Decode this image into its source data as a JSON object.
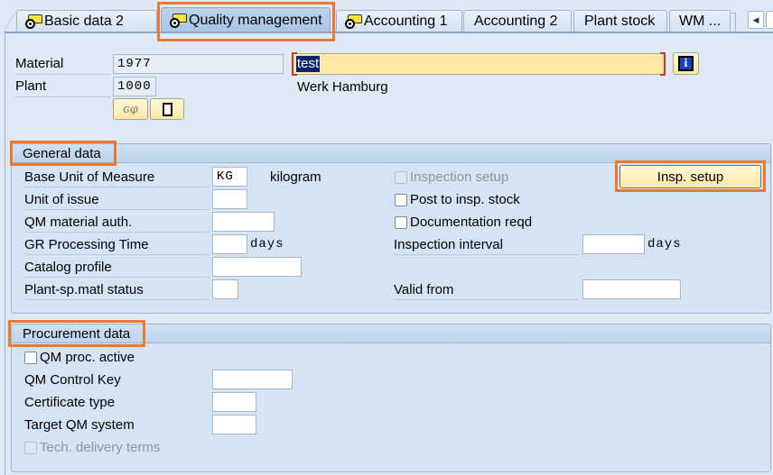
{
  "tabs": [
    {
      "label": "Basic data 2",
      "icon": "camera-lens-icon",
      "active": false
    },
    {
      "label": "Quality management",
      "icon": "camera-lens-icon",
      "active": true
    },
    {
      "label": "Accounting 1",
      "icon": "camera-lens-icon",
      "active": false
    },
    {
      "label": "Accounting 2",
      "active": false
    },
    {
      "label": "Plant stock",
      "active": false
    },
    {
      "label": "WM ...",
      "active": false
    }
  ],
  "tab_scroll": {
    "left_icon": "◀"
  },
  "header": {
    "material_label": "Material",
    "material_value": "1977",
    "material_desc": "test",
    "plant_label": "Plant",
    "plant_value": "1000",
    "plant_desc": "Werk Hamburg",
    "info_icon": "i"
  },
  "general_data": {
    "title": "General data",
    "base_uom_label": "Base Unit of Measure",
    "base_uom_value": "KG",
    "base_uom_text": "kilogram",
    "unit_of_issue_label": "Unit of issue",
    "unit_of_issue_value": "",
    "qm_material_auth_label": "QM material auth.",
    "qm_material_auth_value": "",
    "gr_processing_time_label": "GR Processing Time",
    "gr_processing_time_value": "",
    "gr_processing_time_unit": "days",
    "catalog_profile_label": "Catalog profile",
    "catalog_profile_value": "",
    "plant_matl_status_label": "Plant-sp.matl status",
    "plant_matl_status_value": "",
    "inspection_setup_label": "Inspection setup",
    "inspection_setup_checked": false,
    "insp_setup_button": "Insp. setup",
    "post_to_insp_stock_label": "Post to insp. stock",
    "post_to_insp_stock_checked": false,
    "documentation_reqd_label": "Documentation reqd",
    "documentation_reqd_checked": false,
    "inspection_interval_label": "Inspection interval",
    "inspection_interval_value": "",
    "inspection_interval_unit": "days",
    "valid_from_label": "Valid from",
    "valid_from_value": ""
  },
  "procurement_data": {
    "title": "Procurement data",
    "qm_proc_active_label": "QM proc. active",
    "qm_proc_active_checked": false,
    "qm_control_key_label": "QM Control Key",
    "qm_control_key_value": "",
    "certificate_type_label": "Certificate type",
    "certificate_type_value": "",
    "target_qm_system_label": "Target QM system",
    "target_qm_system_value": "",
    "tech_delivery_terms_label": "Tech. delivery terms",
    "tech_delivery_terms_checked": false
  },
  "colors": {
    "highlight": "#e8792f",
    "selected_text_bg": "#0a246a",
    "required_field_bg": "#fdeaa8"
  }
}
